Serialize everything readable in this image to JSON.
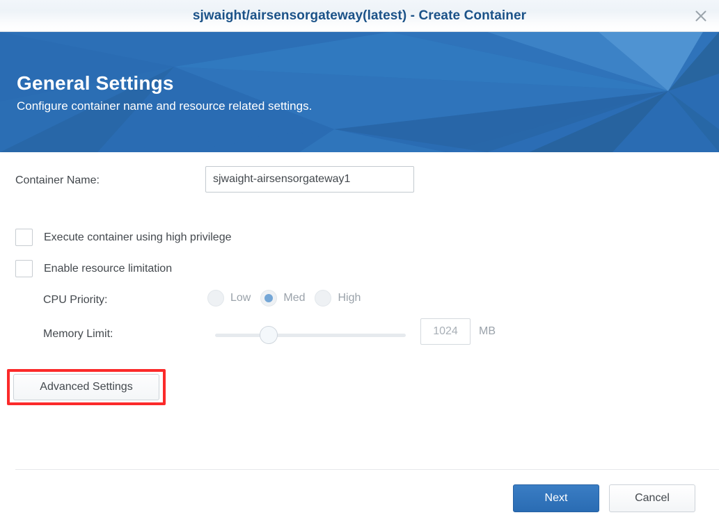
{
  "window": {
    "title": "sjwaight/airsensorgateway(latest) - Create Container",
    "close_icon": "close-icon"
  },
  "banner": {
    "heading": "General Settings",
    "subheading": "Configure container name and resource related settings.",
    "background_color": "#2a6cb3"
  },
  "form": {
    "container_name": {
      "label": "Container Name:",
      "value": "sjwaight-airsensorgateway1",
      "placeholder": ""
    },
    "high_privilege": {
      "label": "Execute container using high privilege",
      "checked": false
    },
    "resource_limitation": {
      "label": "Enable resource limitation",
      "checked": false
    },
    "cpu_priority": {
      "label": "CPU Priority:",
      "options": [
        "Low",
        "Med",
        "High"
      ],
      "selected": "Med",
      "disabled": true
    },
    "memory_limit": {
      "label": "Memory Limit:",
      "value": "1024",
      "unit": "MB",
      "slider_percent": 26,
      "disabled": true
    },
    "advanced_settings": {
      "label": "Advanced Settings"
    }
  },
  "annotation": {
    "highlight_color": "#fb2a2a",
    "target": "Advanced Settings"
  },
  "footer": {
    "next_label": "Next",
    "cancel_label": "Cancel",
    "primary_color": "#2a6cb3"
  }
}
